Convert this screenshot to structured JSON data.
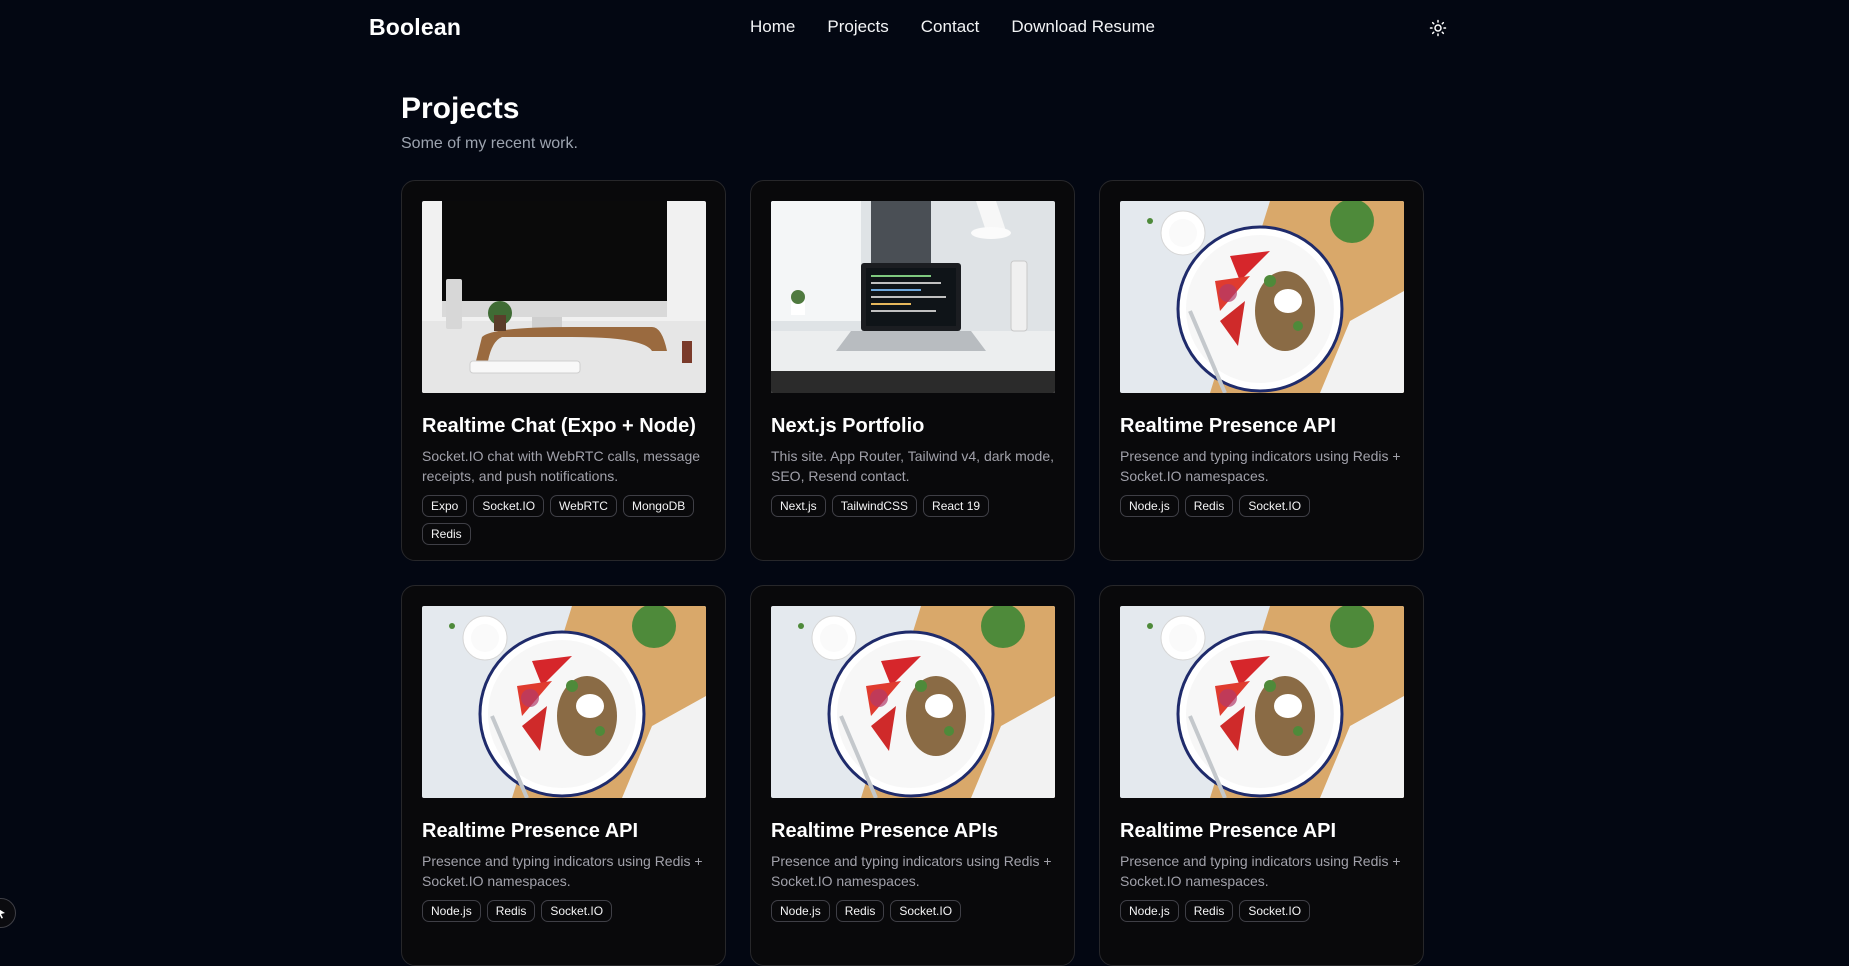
{
  "header": {
    "brand": "Boolean",
    "nav": [
      "Home",
      "Projects",
      "Contact",
      "Download Resume"
    ],
    "theme_toggle_icon": "sun-icon"
  },
  "page": {
    "title": "Projects",
    "subtitle": "Some of my recent work."
  },
  "projects": [
    {
      "image": "desk-imac-photo",
      "title": "Realtime Chat (Expo + Node)",
      "description": "Socket.IO chat with WebRTC calls, message receipts, and push notifications.",
      "tags": [
        "Expo",
        "Socket.IO",
        "WebRTC",
        "MongoDB",
        "Redis"
      ]
    },
    {
      "image": "desk-laptop-photo",
      "title": "Next.js Portfolio",
      "description": "This site. App Router, Tailwind v4, dark mode, SEO, Resend contact.",
      "tags": [
        "Next.js",
        "TailwindCSS",
        "React 19"
      ]
    },
    {
      "image": "food-plate-photo",
      "title": "Realtime Presence API",
      "description": "Presence and typing indicators using Redis + Socket.IO namespaces.",
      "tags": [
        "Node.js",
        "Redis",
        "Socket.IO"
      ]
    },
    {
      "image": "food-plate-photo",
      "title": "Realtime Presence API",
      "description": "Presence and typing indicators using Redis + Socket.IO namespaces.",
      "tags": [
        "Node.js",
        "Redis",
        "Socket.IO"
      ]
    },
    {
      "image": "food-plate-photo",
      "title": "Realtime Presence APIs",
      "description": "Presence and typing indicators using Redis + Socket.IO namespaces.",
      "tags": [
        "Node.js",
        "Redis",
        "Socket.IO"
      ]
    },
    {
      "image": "food-plate-photo",
      "title": "Realtime Presence API",
      "description": "Presence and typing indicators using Redis + Socket.IO namespaces.",
      "tags": [
        "Node.js",
        "Redis",
        "Socket.IO"
      ]
    }
  ],
  "colors": {
    "background": "#030712",
    "card": "#09090b",
    "border": "#27272a",
    "muted_text": "#a1a1aa"
  }
}
